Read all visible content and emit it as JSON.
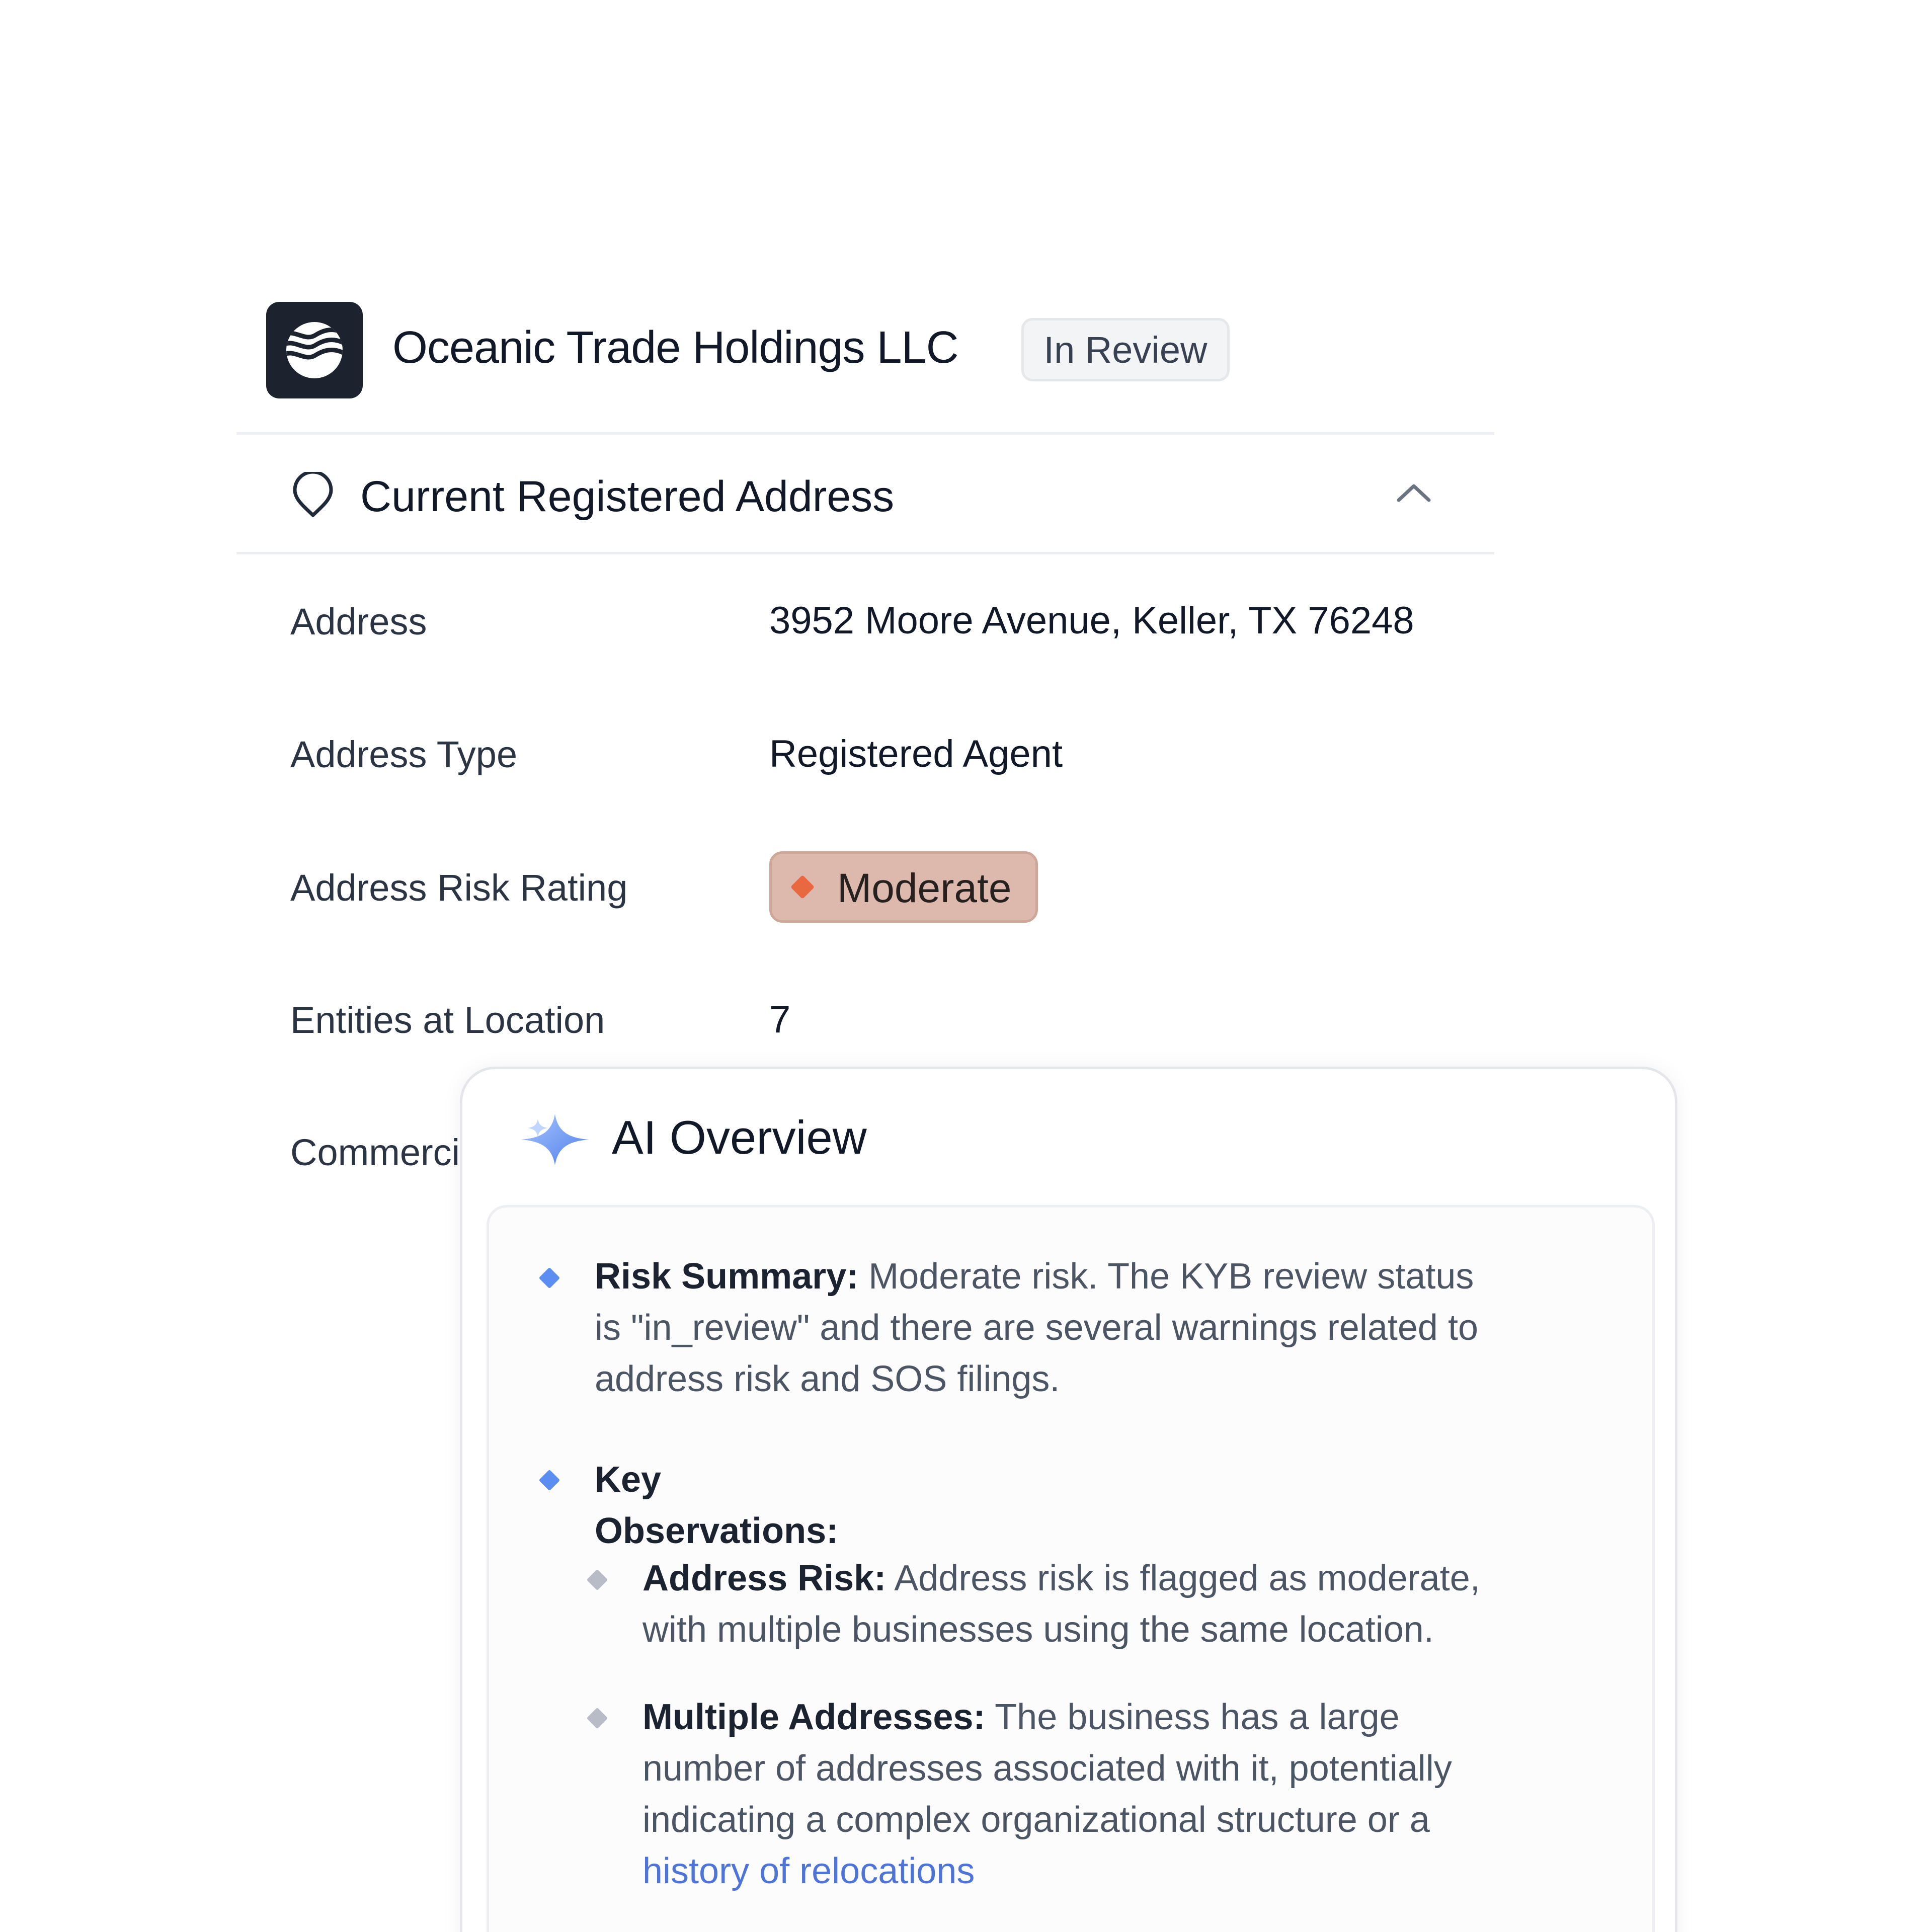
{
  "company": {
    "name": "Oceanic Trade Holdings LLC",
    "status": "In Review",
    "logo_icon": "wave-logo-icon"
  },
  "section": {
    "title": "Current Registered Address",
    "icon": "map-pin-icon",
    "toggle_icon": "chevron-up-icon"
  },
  "fields": {
    "address": {
      "label": "Address",
      "value": "3952 Moore Avenue, Keller, TX 76248"
    },
    "address_type": {
      "label": "Address Type",
      "value": "Registered Agent"
    },
    "risk_rating": {
      "label": "Address Risk Rating",
      "value": "Moderate",
      "color": "#ea6840"
    },
    "entities": {
      "label": "Entities at Location",
      "value": "7"
    },
    "commercial": {
      "label": "Commerci"
    }
  },
  "ai_overview": {
    "title": "AI Overview",
    "icon": "sparkle-icon",
    "accent": "#5b8ef0",
    "risk_summary": {
      "label": "Risk Summary:",
      "line1": " Moderate risk. The KYB review status",
      "line2": "is \"in_review\" and there are several warnings related to",
      "line3": "address risk and SOS filings."
    },
    "key_observations": {
      "label": "Key Observations:"
    },
    "address_risk": {
      "label": "Address Risk:",
      "line1": " Address risk is flagged as moderate,",
      "line2": "with multiple businesses using the same location."
    },
    "multiple_addresses": {
      "label": "Multiple Addresses:",
      "line1": " The business has a large",
      "line2": "number of addresses associated with it, potentially",
      "line3": "indicating a complex organizational structure or a",
      "line4_plain": "history ",
      "line4_link": "of relocations"
    }
  }
}
